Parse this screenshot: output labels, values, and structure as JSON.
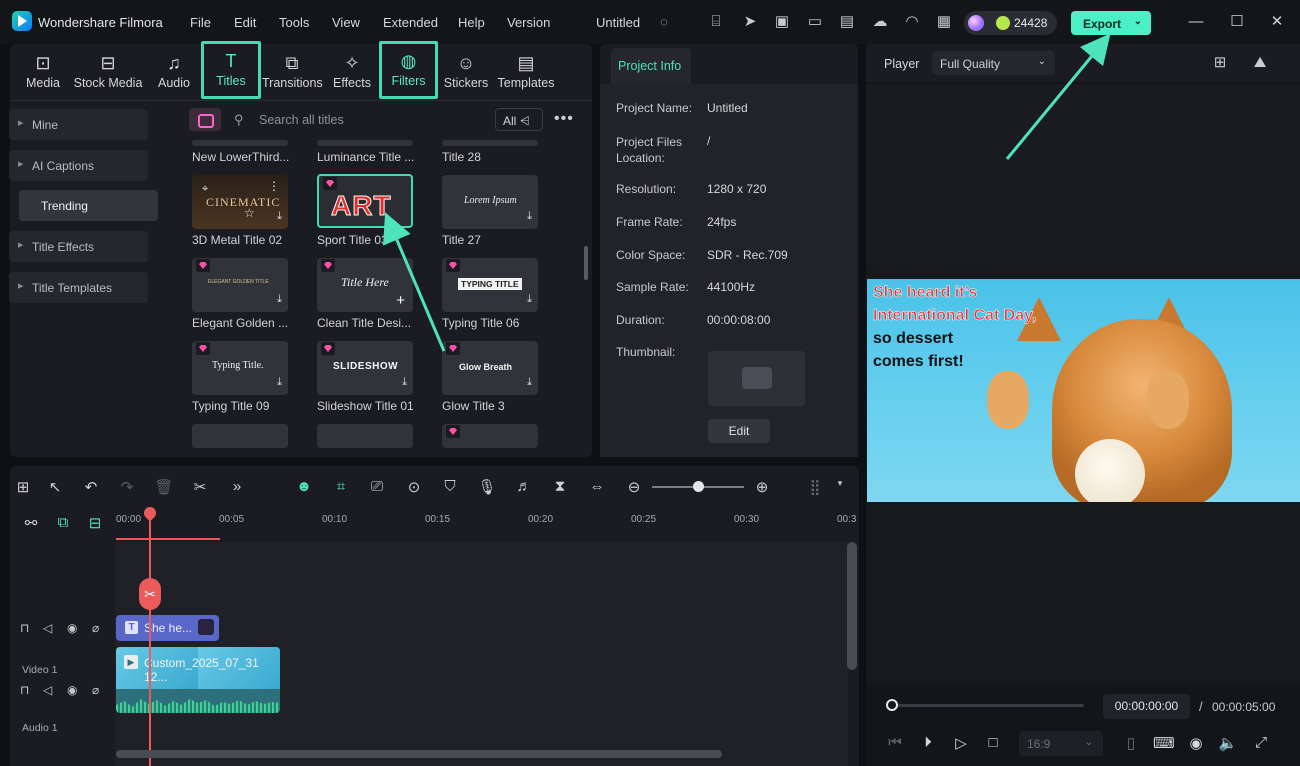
{
  "titlebar": {
    "app_name": "Wondershare Filmora",
    "menus": [
      "File",
      "Edit",
      "Tools",
      "View",
      "Extended",
      "Help",
      "Version"
    ],
    "project_name": "Untitled",
    "credits": "24428",
    "export_label": "Export"
  },
  "library": {
    "tabs": [
      "Media",
      "Stock Media",
      "Audio",
      "Titles",
      "Transitions",
      "Effects",
      "Filters",
      "Stickers",
      "Templates"
    ],
    "selected_tab": "Titles",
    "sidebar": [
      "Mine",
      "AI Captions",
      "Trending",
      "Title Effects",
      "Title Templates"
    ],
    "search_placeholder": "Search all titles",
    "filter_label": "All",
    "grid_labels": [
      "New LowerThird...",
      "Luminance Title ...",
      "Title 28",
      "3D Metal Title 02",
      "Sport Title 03",
      "Title 27",
      "Elegant Golden ...",
      "Clean Title Desi...",
      "Typing Title 06",
      "Typing Title 09",
      "Slideshow Title 01",
      "Glow Title 3"
    ],
    "thumb_texts": [
      "CINEMATIC",
      "ART",
      "Lorem Ipsum",
      "ELEGANT GOLDEN TITLE",
      "Title Here",
      "TYPING TITLE",
      "Typing Title.",
      "SLIDESHOW",
      "Glow Breath"
    ]
  },
  "project_info": {
    "tab": "Project Info",
    "rows": [
      {
        "k": "Project Name:",
        "v": "Untitled"
      },
      {
        "k": "Project Files Location:",
        "v": "/"
      },
      {
        "k": "Resolution:",
        "v": "1280 x 720"
      },
      {
        "k": "Frame Rate:",
        "v": "24fps"
      },
      {
        "k": "Color Space:",
        "v": "SDR - Rec.709"
      },
      {
        "k": "Sample Rate:",
        "v": "44100Hz"
      },
      {
        "k": "Duration:",
        "v": "00:00:08:00"
      },
      {
        "k": "Thumbnail:",
        "v": ""
      }
    ],
    "edit_label": "Edit"
  },
  "player": {
    "label": "Player",
    "quality": "Full Quality",
    "caption_lines": [
      "She heard it’s",
      "International Cat Day,",
      "so dessert",
      "comes first!"
    ],
    "current_time": "00:00:00:00",
    "separator": "/",
    "duration": "00:00:05:00",
    "ratio": "16:9",
    "progress": 0
  },
  "timeline": {
    "ticks": [
      "00:00",
      "00:05",
      "00:10",
      "00:15",
      "00:20",
      "00:25",
      "00:30",
      "00:3"
    ],
    "tracks": [
      "Video 1",
      "Audio 1"
    ],
    "title_clip": "She he...",
    "video_clip": "Custom_2025_07_31 12..."
  },
  "colors": {
    "accent": "#4cf0c6",
    "playhead": "#ec5b5b",
    "title_clip": "#5967c9"
  }
}
